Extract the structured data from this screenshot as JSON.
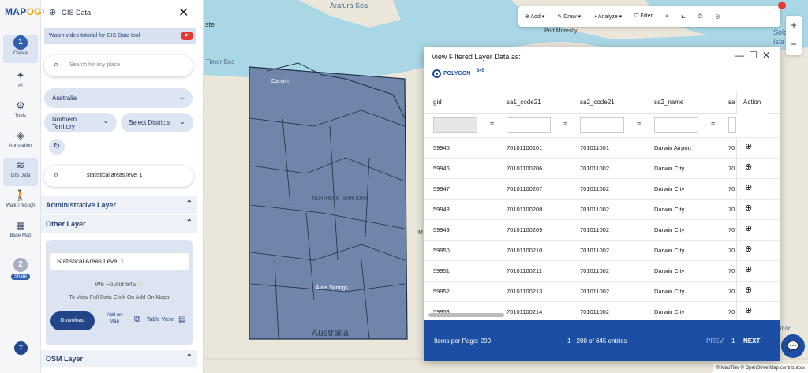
{
  "app": {
    "logo_text": "MAPOG",
    "logo_text_a": "MAP",
    "logo_text_b": "OG"
  },
  "rail": {
    "items": [
      {
        "num": "1",
        "label": "Create"
      },
      {
        "label": "AI"
      },
      {
        "label": "Tools"
      },
      {
        "label": "Annotation"
      },
      {
        "label": "GIS Data"
      },
      {
        "label": "Walk Through"
      },
      {
        "label": "Base Map"
      },
      {
        "num": "2",
        "label": "Share"
      }
    ],
    "user_initial": "T"
  },
  "panel": {
    "title": "GIS Data",
    "tutorial_text": "Watch video tutorial for GIS Data tool",
    "search_placeholder": "Search for any place",
    "country": "Australia",
    "state": "Northern Territory",
    "districts_label": "Select Districts",
    "layer_search_value": "statistical areas level 1",
    "sections": {
      "admin": "Administrative Layer",
      "other": "Other Layer",
      "osm": "OSM Layer"
    },
    "card": {
      "layer_name": "Statistical Areas Level 1",
      "found_label": "We Found",
      "found_count": "645",
      "hint": "To View Full Data Click On Add On Maps",
      "download": "Download",
      "add_on_map": "Add on Map",
      "table_view": "Table View"
    }
  },
  "map": {
    "labels": [
      "Arafura Sea",
      "Port Moresby",
      "Timor Sea",
      "Australia",
      "NORTHERN TERRITORY",
      "Alice Springs",
      "Darwin",
      "ste",
      "Solo",
      "Isla",
      "ution",
      "M"
    ],
    "attribution": "© MapTiler © OpenStreetMap contributors"
  },
  "toolbar": {
    "add": "Add",
    "draw": "Draw",
    "analyze": "Analyze",
    "filter": "Filter"
  },
  "popup": {
    "title": "View Filtered Layer Data as:",
    "type": "POLYGON",
    "count": "645",
    "columns": [
      "gid",
      "sa1_code21",
      "sa2_code21",
      "sa2_name",
      "sa",
      "Action"
    ],
    "rows": [
      [
        "59945",
        "70101100101",
        "701011001",
        "Darwin Airport",
        "70"
      ],
      [
        "59946",
        "70101100206",
        "701011002",
        "Darwin City",
        "70"
      ],
      [
        "59947",
        "70101100207",
        "701011002",
        "Darwin City",
        "70"
      ],
      [
        "59948",
        "70101100208",
        "701011002",
        "Darwin City",
        "70"
      ],
      [
        "59949",
        "70101100209",
        "701011002",
        "Darwin City",
        "70"
      ],
      [
        "59950",
        "70101100210",
        "701011002",
        "Darwin City",
        "70"
      ],
      [
        "59951",
        "70101100211",
        "701011002",
        "Darwin City",
        "70"
      ],
      [
        "59952",
        "70101100213",
        "701011002",
        "Darwin City",
        "70"
      ],
      [
        "59953",
        "70101100214",
        "701011002",
        "Darwin City",
        "70"
      ]
    ],
    "footer": {
      "items_per_page": "Items per Page: 200",
      "range": "1 - 200 of 645 entries",
      "prev": "PREV",
      "page": "1",
      "next": "NEXT"
    }
  }
}
